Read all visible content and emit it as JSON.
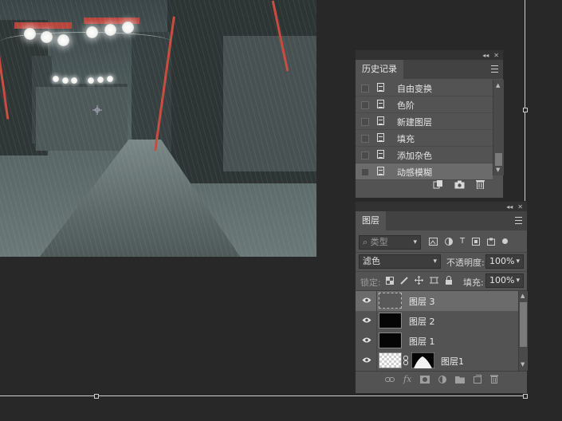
{
  "history": {
    "tab": "历史记录",
    "items": [
      {
        "label": "自由变换"
      },
      {
        "label": "色阶"
      },
      {
        "label": "新建图层"
      },
      {
        "label": "填充"
      },
      {
        "label": "添加杂色"
      },
      {
        "label": "动感模糊",
        "selected": true
      }
    ]
  },
  "layers": {
    "tab": "图层",
    "filter_placeholder": "类型",
    "blend_mode": "滤色",
    "opacity_label": "不透明度:",
    "opacity_value": "100%",
    "lock_label": "锁定:",
    "fill_label": "填充:",
    "fill_value": "100%",
    "items": [
      {
        "name": "图层 3",
        "thumb": "dashed-gray",
        "selected": true
      },
      {
        "name": "图层 2",
        "thumb": "black"
      },
      {
        "name": "图层 1",
        "thumb": "black"
      },
      {
        "name": "图层1",
        "thumb": "transparent-with-mask"
      }
    ],
    "footer_fx": "fx"
  },
  "colors": {
    "app_bg": "#282828",
    "panel": "#535353",
    "selected_row": "#6b6b6b",
    "lantern_pole": "#c84b3e"
  }
}
